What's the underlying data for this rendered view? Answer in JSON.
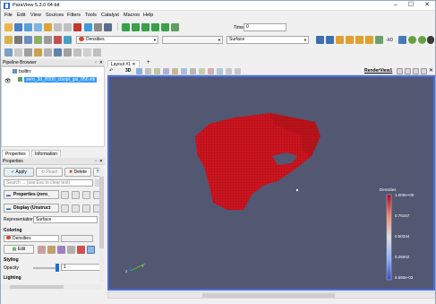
{
  "window": {
    "title": "ParaView 5.3.0 64-bit"
  },
  "menu": [
    "File",
    "Edit",
    "View",
    "Sources",
    "Filters",
    "Tools",
    "Catalyst",
    "Macros",
    "Help"
  ],
  "toolbar": {
    "color_by": "Densities",
    "representation": "Surface",
    "time_label": "Time:",
    "time_value": "0",
    "zoom_label": "-X0"
  },
  "pipeline": {
    "title": "Pipeline Browser",
    "builtin": "builtin:",
    "file": "zero_3d_H100_ctsopt_gal_050.vtk"
  },
  "tabs": {
    "properties": "Properties",
    "information": "Information"
  },
  "properties": {
    "header": "Properties",
    "apply": "Apply",
    "reset": "Reset",
    "delete": "Delete",
    "help": "?",
    "search_placeholder": "Search ... (use Esc to clear text)",
    "section_properties": "Properties (zero_",
    "section_display": "Display (Unstruct",
    "representation_label": "Representation",
    "representation_value": "Surface",
    "coloring_label": "Coloring",
    "coloring_value": "Densities",
    "edit": "Edit",
    "styling_label": "Styling",
    "opacity_label": "Opacity",
    "opacity_value": "1",
    "lighting_label": "Lighting"
  },
  "layout": {
    "tab": "Layout #1",
    "add": "+",
    "render_view": "RenderView1"
  },
  "colorbar": {
    "title": "Densities",
    "labels": [
      "1.000e+00",
      "0.75167",
      "0.50334",
      "0.25502",
      "6.690e-03"
    ]
  },
  "colors": {
    "viewport_bg": "#525772",
    "object": "#c8141e",
    "selection": "#3399ff"
  }
}
